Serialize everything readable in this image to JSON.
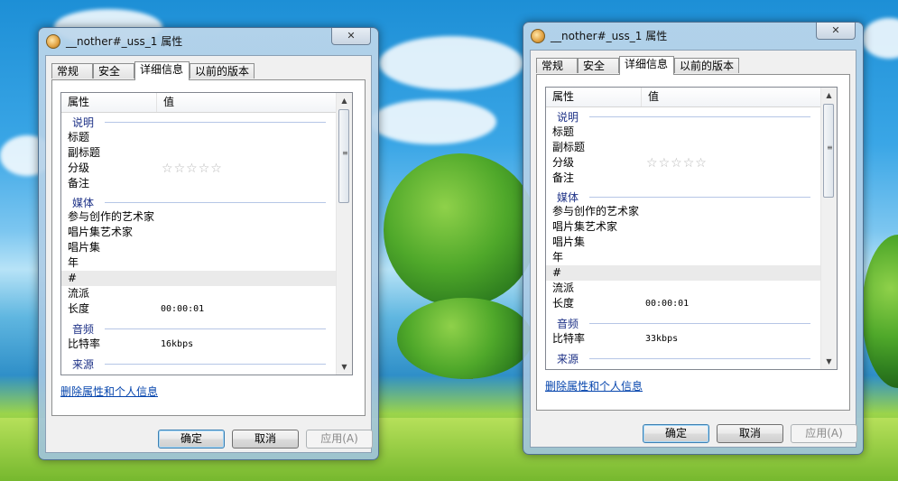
{
  "dialogs": [
    {
      "title": "__nother#_uss_1 属性",
      "tabs": [
        "常规",
        "安全",
        "详细信息",
        "以前的版本"
      ],
      "active_tab": "详细信息",
      "columns": [
        "属性",
        "值"
      ],
      "groups": [
        {
          "label": "说明",
          "rows": [
            {
              "k": "标题",
              "v": ""
            },
            {
              "k": "副标题",
              "v": ""
            },
            {
              "k": "分级",
              "v": "",
              "rating_stars": 5
            },
            {
              "k": "备注",
              "v": ""
            }
          ]
        },
        {
          "label": "媒体",
          "rows": [
            {
              "k": "参与创作的艺术家",
              "v": ""
            },
            {
              "k": "唱片集艺术家",
              "v": ""
            },
            {
              "k": "唱片集",
              "v": ""
            },
            {
              "k": "年",
              "v": ""
            },
            {
              "k": "#",
              "v": "",
              "selected": true
            },
            {
              "k": "流派",
              "v": ""
            },
            {
              "k": "长度",
              "v": "00:00:01"
            }
          ]
        },
        {
          "label": "音频",
          "rows": [
            {
              "k": "比特率",
              "v": "16kbps"
            }
          ]
        },
        {
          "label": "来源",
          "rows": []
        }
      ],
      "link": "删除属性和个人信息",
      "buttons": {
        "ok": "确定",
        "cancel": "取消",
        "apply": "应用(A)"
      }
    },
    {
      "title": "__nother#_uss_1 属性",
      "tabs": [
        "常规",
        "安全",
        "详细信息",
        "以前的版本"
      ],
      "active_tab": "详细信息",
      "columns": [
        "属性",
        "值"
      ],
      "groups": [
        {
          "label": "说明",
          "rows": [
            {
              "k": "标题",
              "v": ""
            },
            {
              "k": "副标题",
              "v": ""
            },
            {
              "k": "分级",
              "v": "",
              "rating_stars": 5
            },
            {
              "k": "备注",
              "v": ""
            }
          ]
        },
        {
          "label": "媒体",
          "rows": [
            {
              "k": "参与创作的艺术家",
              "v": ""
            },
            {
              "k": "唱片集艺术家",
              "v": ""
            },
            {
              "k": "唱片集",
              "v": ""
            },
            {
              "k": "年",
              "v": ""
            },
            {
              "k": "#",
              "v": "",
              "selected": true
            },
            {
              "k": "流派",
              "v": ""
            },
            {
              "k": "长度",
              "v": "00:00:01"
            }
          ]
        },
        {
          "label": "音频",
          "rows": [
            {
              "k": "比特率",
              "v": "33kbps"
            }
          ]
        },
        {
          "label": "来源",
          "rows": []
        }
      ],
      "link": "删除属性和个人信息",
      "buttons": {
        "ok": "确定",
        "cancel": "取消",
        "apply": "应用(A)"
      }
    }
  ],
  "icons": {
    "close": "close-icon",
    "star": "star-icon",
    "app": "audio-file-icon"
  }
}
